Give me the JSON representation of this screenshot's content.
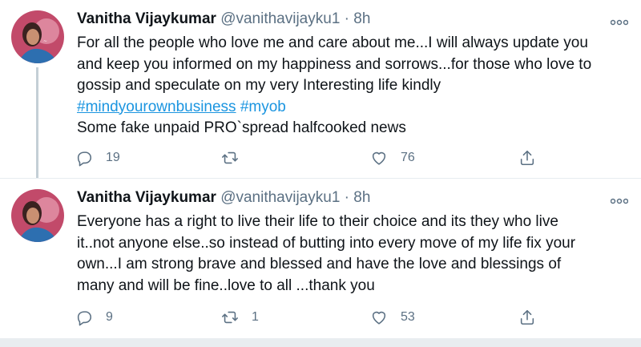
{
  "tweets": [
    {
      "author_name": "Vanitha Vijaykumar",
      "handle": "@vanithavijayku1",
      "separator": "·",
      "time": "8h",
      "more_icon": "ooo",
      "lines": [
        "For all the people who love me and care about me...I will always update you",
        "and keep you informed on my happiness and sorrows...for those who love to",
        "gossip and speculate on my very Interesting life kindly"
      ],
      "hashtags": [
        "#mindyourownbusiness",
        "#myob"
      ],
      "last_line": "Some fake unpaid PRO`spread halfcooked news",
      "replies": "19",
      "retweets": "",
      "likes": "76"
    },
    {
      "author_name": "Vanitha Vijaykumar",
      "handle": "@vanithavijayku1",
      "separator": "·",
      "time": "8h",
      "more_icon": "ooo",
      "lines": [
        "Everyone has a right to live their life to their choice and its they who live",
        "it..not anyone else..so instead of butting into every move of my life fix your",
        "own...I am strong brave and blessed and have the love and blessings of",
        "many and will be fine..love to all ...thank you"
      ],
      "replies": "9",
      "retweets": "1",
      "likes": "53"
    }
  ],
  "colors": {
    "text": "#0f1419",
    "secondary": "#5b7083",
    "link": "#1b95e0",
    "thread_line": "#c4cfd6"
  },
  "icons": {
    "reply": "reply-icon",
    "retweet": "retweet-icon",
    "like": "heart-icon",
    "share": "share-icon",
    "more": "more-icon"
  }
}
